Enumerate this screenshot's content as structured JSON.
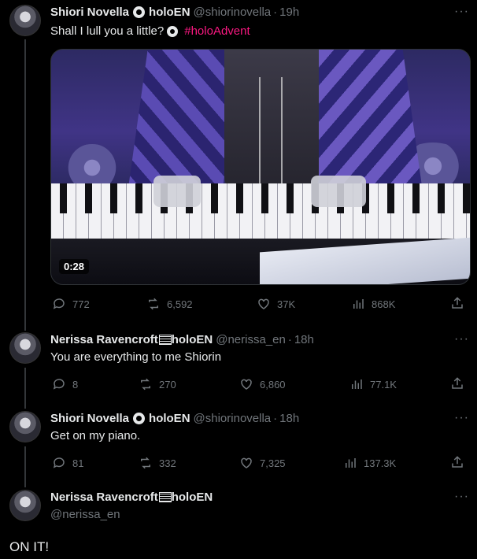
{
  "thread": [
    {
      "author_name": "Shiori Novella",
      "org": "holoEN",
      "handle": "@shiorinovella",
      "time": "19h",
      "text": "Shall I lull you a little?",
      "hashtag": "#holoAdvent",
      "media": {
        "duration": "0:28"
      },
      "stats": {
        "replies": "772",
        "retweets": "6,592",
        "likes": "37K",
        "views": "868K"
      }
    },
    {
      "author_name": "Nerissa Ravencroft",
      "org": "holoEN",
      "handle": "@nerissa_en",
      "time": "18h",
      "text": "You are everything to me Shiorin",
      "stats": {
        "replies": "8",
        "retweets": "270",
        "likes": "6,860",
        "views": "77.1K"
      }
    },
    {
      "author_name": "Shiori Novella",
      "org": "holoEN",
      "handle": "@shiorinovella",
      "time": "18h",
      "text": "Get on my piano.",
      "stats": {
        "replies": "81",
        "retweets": "332",
        "likes": "7,325",
        "views": "137.3K"
      }
    },
    {
      "author_name": "Nerissa Ravencroft",
      "org": "holoEN",
      "handle": "@nerissa_en",
      "text": "ON IT!"
    }
  ],
  "ui": {
    "separator": "·",
    "more": "···"
  },
  "colors": {
    "background": "#000000",
    "text": "#e7e9ea",
    "muted": "#71767b",
    "hashtag": "#f91880"
  }
}
